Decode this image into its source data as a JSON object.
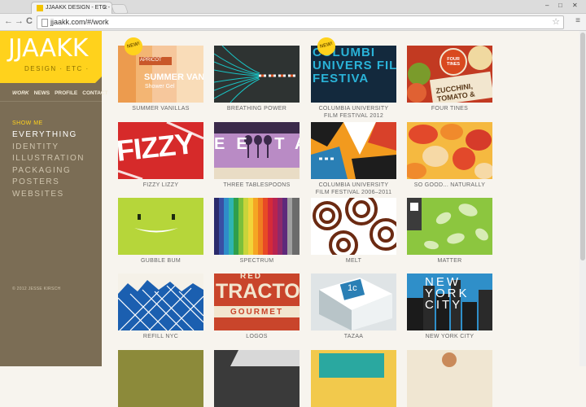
{
  "browser": {
    "tab_title": "JJAAKK DESIGN - ETC -",
    "tab_close": "×",
    "url": "jjaakk.com/#/work",
    "back_icon": "←",
    "forward_icon": "→",
    "reload_icon": "C",
    "star_icon": "☆",
    "menu_icon": "≡",
    "window_minimize": "–",
    "window_maximize": "□",
    "window_close": "✕"
  },
  "sidebar": {
    "logo_main": "JJAAKK",
    "logo_sub": "DESIGN · ETC ·",
    "topnav": [
      "WORK",
      "NEWS",
      "PROFILE",
      "CONTACT"
    ],
    "show_me": "SHOW ME",
    "categories": [
      "EVERYTHING",
      "IDENTITY",
      "ILLUSTRATION",
      "PACKAGING",
      "POSTERS",
      "WEBSITES"
    ],
    "active_category": "EVERYTHING",
    "copyright": "© 2012 JESSE KIRSCH",
    "accent_color": "#ffd21c",
    "sidebar_color": "#7b6d55"
  },
  "badge_text": "NEW!",
  "works": [
    {
      "title": "SUMMER VANILLAS",
      "new": true,
      "art": "SUMMER VANILL",
      "art2": "Shower Gel",
      "art3": "APRICOT"
    },
    {
      "title": "BREATHING POWER",
      "new": false
    },
    {
      "title": "COLUMBIA UNIVERSITY FILM FESTIVAL 2012",
      "new": true,
      "art": "COLUMBI UNIVERS FILM FESTIVA"
    },
    {
      "title": "FOUR TINES",
      "new": false,
      "art": "FOUR TINES",
      "art2": "ZUCCHINI, TOMATO &"
    },
    {
      "title": "FIZZY LIZZY",
      "new": false,
      "art": "FIZZY"
    },
    {
      "title": "THREE TABLESPOONS",
      "new": false,
      "art": "EE TA"
    },
    {
      "title": "COLUMBIA UNIVERSITY FILM FESTIVAL 2006–2011",
      "new": false
    },
    {
      "title": "SO GOOD... NATURALLY",
      "new": false
    },
    {
      "title": "GUBBLE BUM",
      "new": false
    },
    {
      "title": "SPECTRUM",
      "new": false
    },
    {
      "title": "MELT",
      "new": false
    },
    {
      "title": "MATTER",
      "new": false
    },
    {
      "title": "REFILL NYC",
      "new": false
    },
    {
      "title": "LOGOS",
      "new": false,
      "art": "TRACTO",
      "art2": "GOURMET",
      "art3": "RED"
    },
    {
      "title": "TAZAA",
      "new": false,
      "art": "1c"
    },
    {
      "title": "NEW YORK CITY",
      "new": false,
      "art": "NEW YORK CITY"
    }
  ]
}
